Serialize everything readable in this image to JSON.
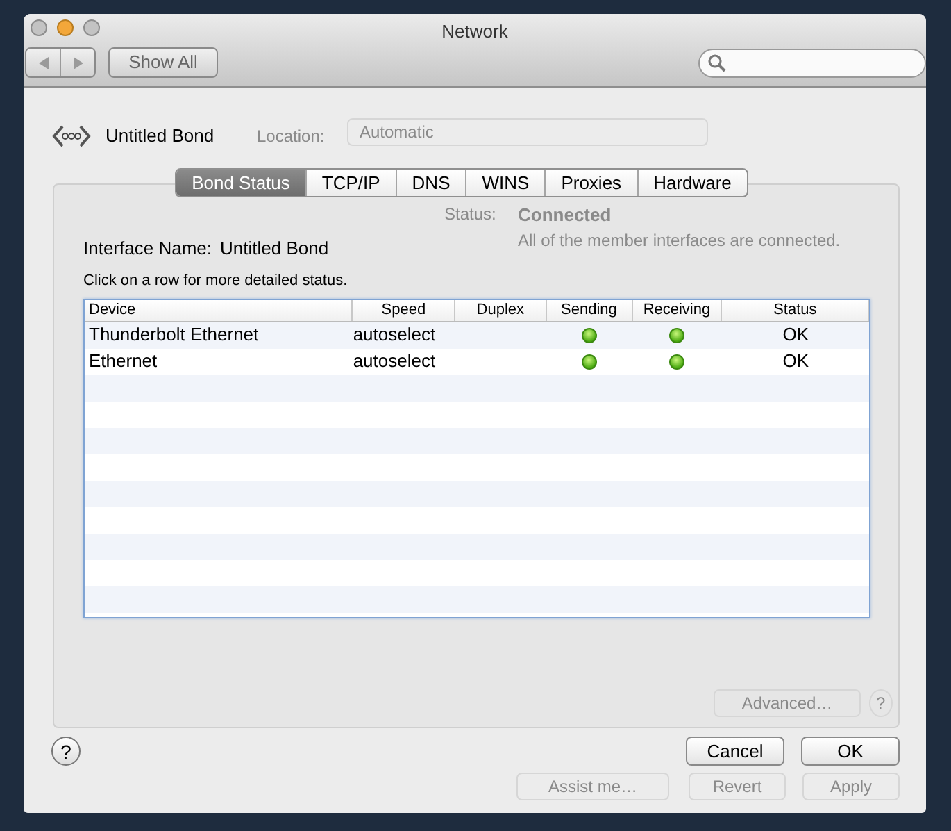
{
  "window": {
    "title": "Network"
  },
  "toolbar": {
    "show_all": "Show All"
  },
  "background": {
    "location_label": "Location:",
    "location_value": "Automatic",
    "status_label": "Status:",
    "status_value": "Connected",
    "status_detail": "All of the member interfaces are connected.",
    "advanced_button": "Advanced…",
    "help": "?",
    "bottom_buttons": [
      "Assist me…",
      "Revert",
      "Apply"
    ]
  },
  "sheet": {
    "interface_title": "Untitled Bond",
    "tabs": [
      {
        "label": "Bond Status",
        "selected": true
      },
      {
        "label": "TCP/IP",
        "selected": false
      },
      {
        "label": "DNS",
        "selected": false
      },
      {
        "label": "WINS",
        "selected": false
      },
      {
        "label": "Proxies",
        "selected": false
      },
      {
        "label": "Hardware",
        "selected": false
      }
    ],
    "interface_name_label": "Interface Name:",
    "interface_name_value": "Untitled Bond",
    "hint": "Click on a row for more detailed status.",
    "table": {
      "columns": [
        "Device",
        "Speed",
        "Duplex",
        "Sending",
        "Receiving",
        "Status"
      ],
      "rows": [
        {
          "device": "Thunderbolt Ethernet",
          "speed": "autoselect",
          "sending": true,
          "receiving": true,
          "status": "OK"
        },
        {
          "device": "Ethernet",
          "speed": "autoselect",
          "sending": true,
          "receiving": true,
          "status": "OK"
        }
      ]
    },
    "help": "?",
    "buttons": [
      "Cancel",
      "OK"
    ]
  }
}
